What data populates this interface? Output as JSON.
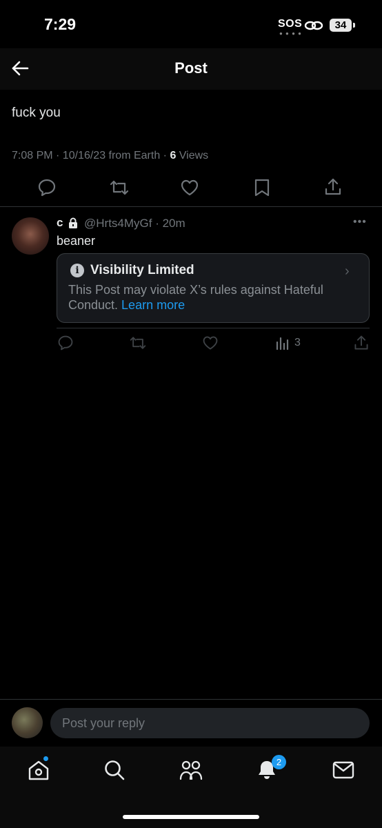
{
  "status_bar": {
    "time": "7:29",
    "sos": "SOS",
    "battery": "34"
  },
  "header": {
    "title": "Post"
  },
  "post": {
    "text": "fuck you",
    "meta_prefix": "7:08 PM · 10/16/23 from Earth · ",
    "views_count": "6",
    "views_label": " Views"
  },
  "reply": {
    "name": "c",
    "handle_time": "@Hrts4MyGf · 20m",
    "text": "beaner",
    "notice_title": "Visibility Limited",
    "notice_body": "This Post may violate X’s rules against Hateful Conduct. ",
    "notice_link": "Learn more",
    "views": "3"
  },
  "compose": {
    "placeholder": "Post your reply"
  },
  "tabbar": {
    "notifications_badge": "2"
  },
  "colors": {
    "accent": "#1d9bf0",
    "background": "#000000",
    "muted": "#71767b"
  }
}
